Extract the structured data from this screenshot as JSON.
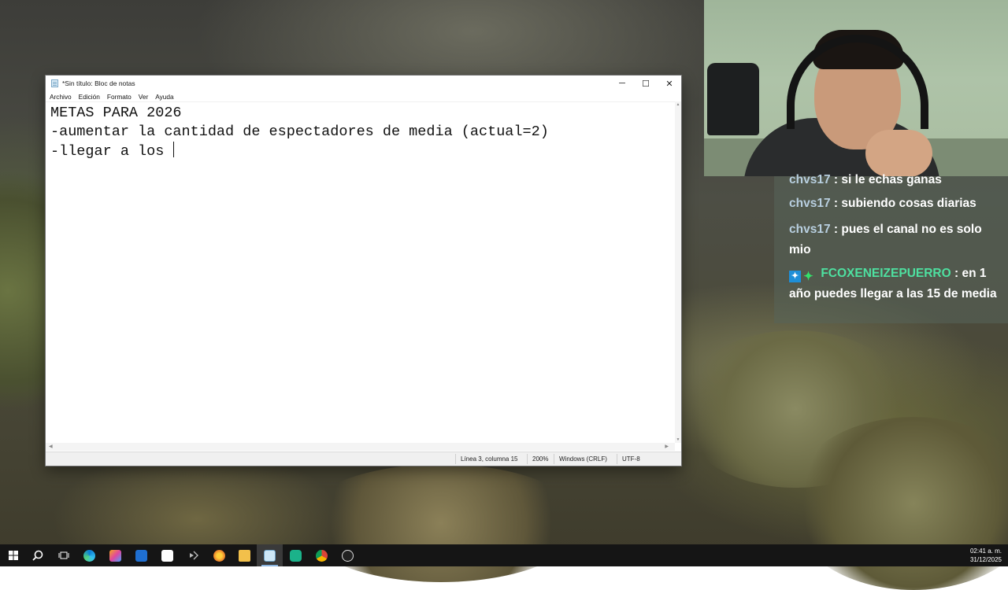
{
  "notepad": {
    "title": "*Sin título: Bloc de notas",
    "menu": [
      "Archivo",
      "Edición",
      "Formato",
      "Ver",
      "Ayuda"
    ],
    "window_controls": {
      "minimize": "─",
      "maximize": "☐",
      "close": "✕"
    },
    "lines": [
      "METAS PARA 2026",
      "-aumentar la cantidad de espectadores de media (actual=2)",
      "-llegar a los "
    ],
    "status": {
      "position": "Línea 3, columna 15",
      "zoom": "200%",
      "line_ending": "Windows (CRLF)",
      "encoding": "UTF-8"
    }
  },
  "chat": {
    "messages": [
      {
        "user": "chvs17",
        "text": ": si le echas ganas",
        "badges": false
      },
      {
        "user": "chvs17",
        "text": ": subiendo cosas diarias",
        "badges": false
      },
      {
        "user": "chvs17",
        "text": ": pues el canal no es solo mio",
        "badges": false
      },
      {
        "user": "FCOXENEIZEPUERRO",
        "text": ": en 1 año puedes llegar a las 15 de media",
        "badges": true
      }
    ]
  },
  "taskbar": {
    "icons": [
      "windows-start",
      "search",
      "task-view",
      "edge",
      "copilot",
      "mail",
      "store",
      "visual-studio",
      "browser-orange",
      "file-explorer",
      "notepad",
      "app-green",
      "chrome",
      "obs"
    ],
    "time": "02:41 a. m.",
    "date": "31/12/2025"
  },
  "colors": {
    "taskbar": "#151515",
    "chat_user": "#b8cfe0",
    "chat_user_highlight": "#4ee0a0"
  }
}
